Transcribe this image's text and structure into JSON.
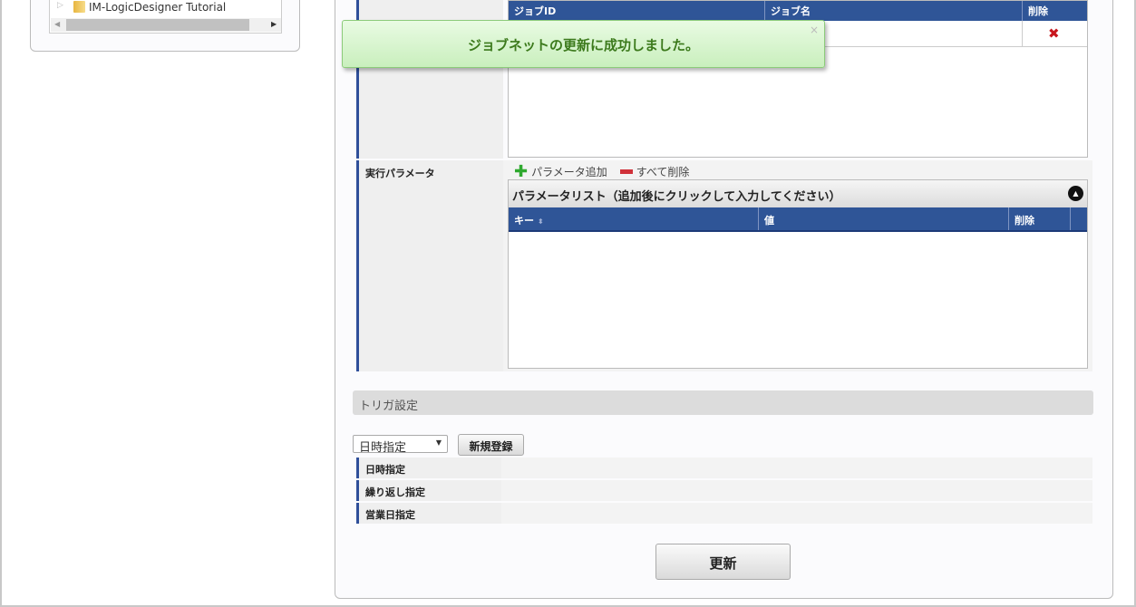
{
  "tree": {
    "item": "IM-LogicDesigner Tutorial"
  },
  "toast": {
    "message": "ジョブネットの更新に成功しました。",
    "close": "×"
  },
  "jobs": {
    "columns": [
      "ジョブID",
      "ジョブ名",
      "削除"
    ],
    "delete_icon": "✖"
  },
  "params": {
    "label": "実行パラメータ",
    "add": "パラメータ追加",
    "delete_all": "すべて削除",
    "list_title": "パラメータリスト（追加後にクリックして入力してください）",
    "columns": [
      "キー",
      "値",
      "削除"
    ]
  },
  "trigger": {
    "title": "トリガ設定",
    "select_value": "日時指定",
    "new_button": "新規登録",
    "rows": [
      "日時指定",
      "繰り返し指定",
      "営業日指定"
    ]
  },
  "update_button": "更新"
}
